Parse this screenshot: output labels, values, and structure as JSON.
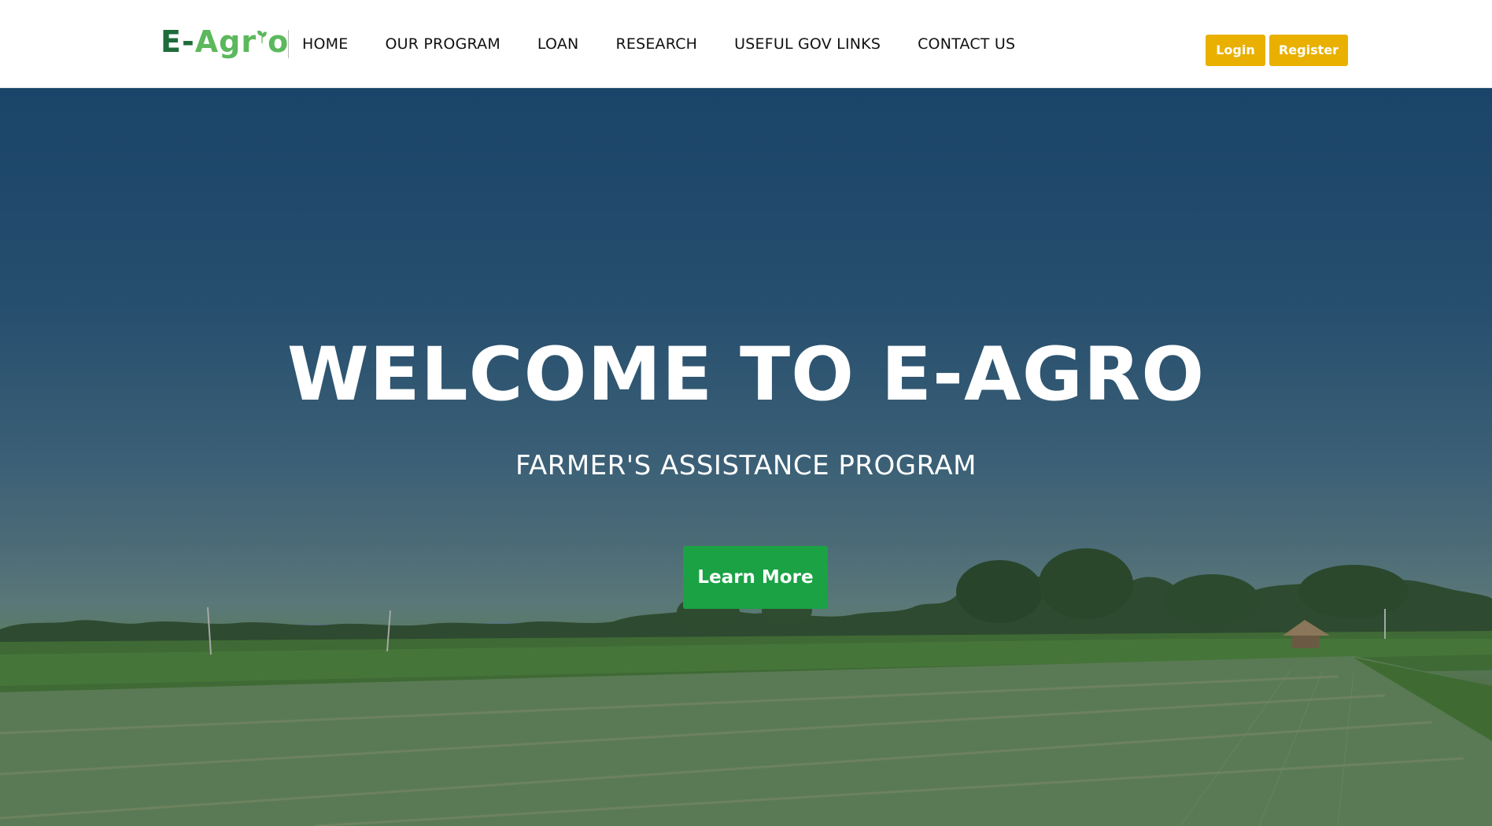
{
  "brand": {
    "logo_prefix": "E-",
    "logo_mid": "Ag",
    "logo_r": "r",
    "logo_end": "o"
  },
  "nav": {
    "items": [
      {
        "label": "HOME"
      },
      {
        "label": "OUR PROGRAM"
      },
      {
        "label": "LOAN"
      },
      {
        "label": "RESEARCH"
      },
      {
        "label": "USEFUL GOV LINKS"
      },
      {
        "label": "CONTACT US"
      }
    ]
  },
  "auth": {
    "login_label": "Login",
    "register_label": "Register"
  },
  "hero": {
    "title": "WELCOME TO E-AGRO",
    "subtitle": "FARMER'S ASSISTANCE PROGRAM",
    "cta_label": "Learn More"
  },
  "colors": {
    "accent_yellow": "#e9b000",
    "cta_green": "#1aa244",
    "logo_dark_green": "#1f6b3b",
    "logo_light_green": "#5cb85c"
  }
}
